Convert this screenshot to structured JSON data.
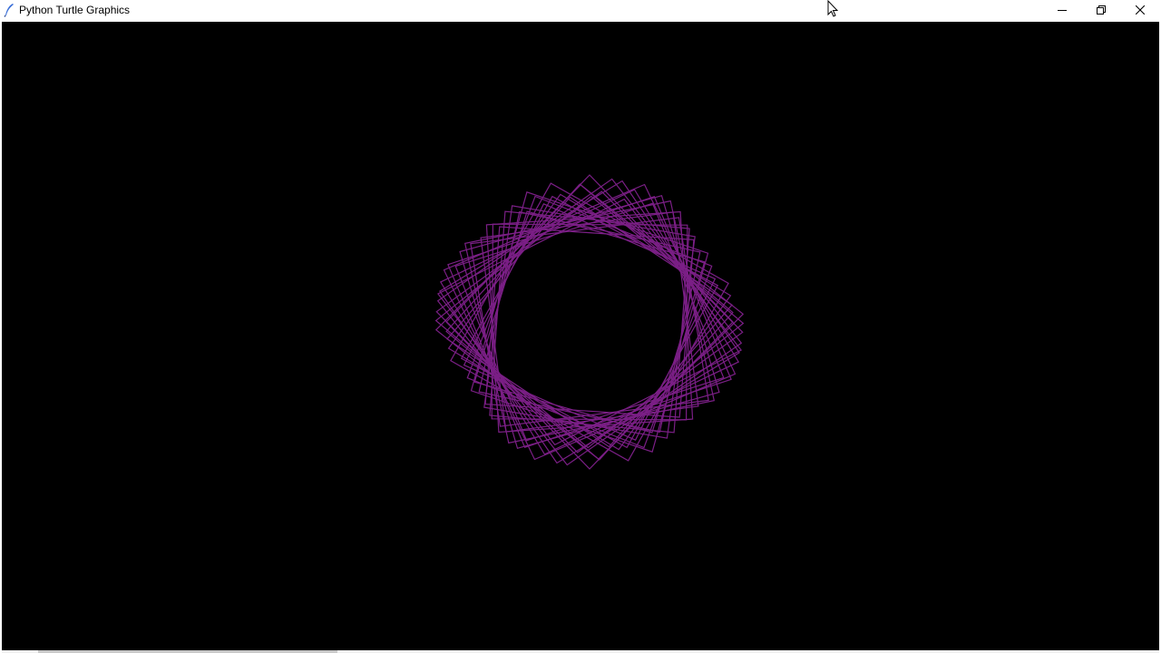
{
  "window": {
    "title": "Python Turtle Graphics",
    "icon": "feather-pen-icon",
    "controls": [
      "minimize-icon",
      "restore-icon",
      "close-icon"
    ]
  },
  "canvas": {
    "background": "#000000",
    "pen_color": "#7b1f86",
    "drawing": "rotated-square-spirograph"
  },
  "colors": {
    "titlebar": "#ffffff",
    "title_text": "#000000"
  }
}
